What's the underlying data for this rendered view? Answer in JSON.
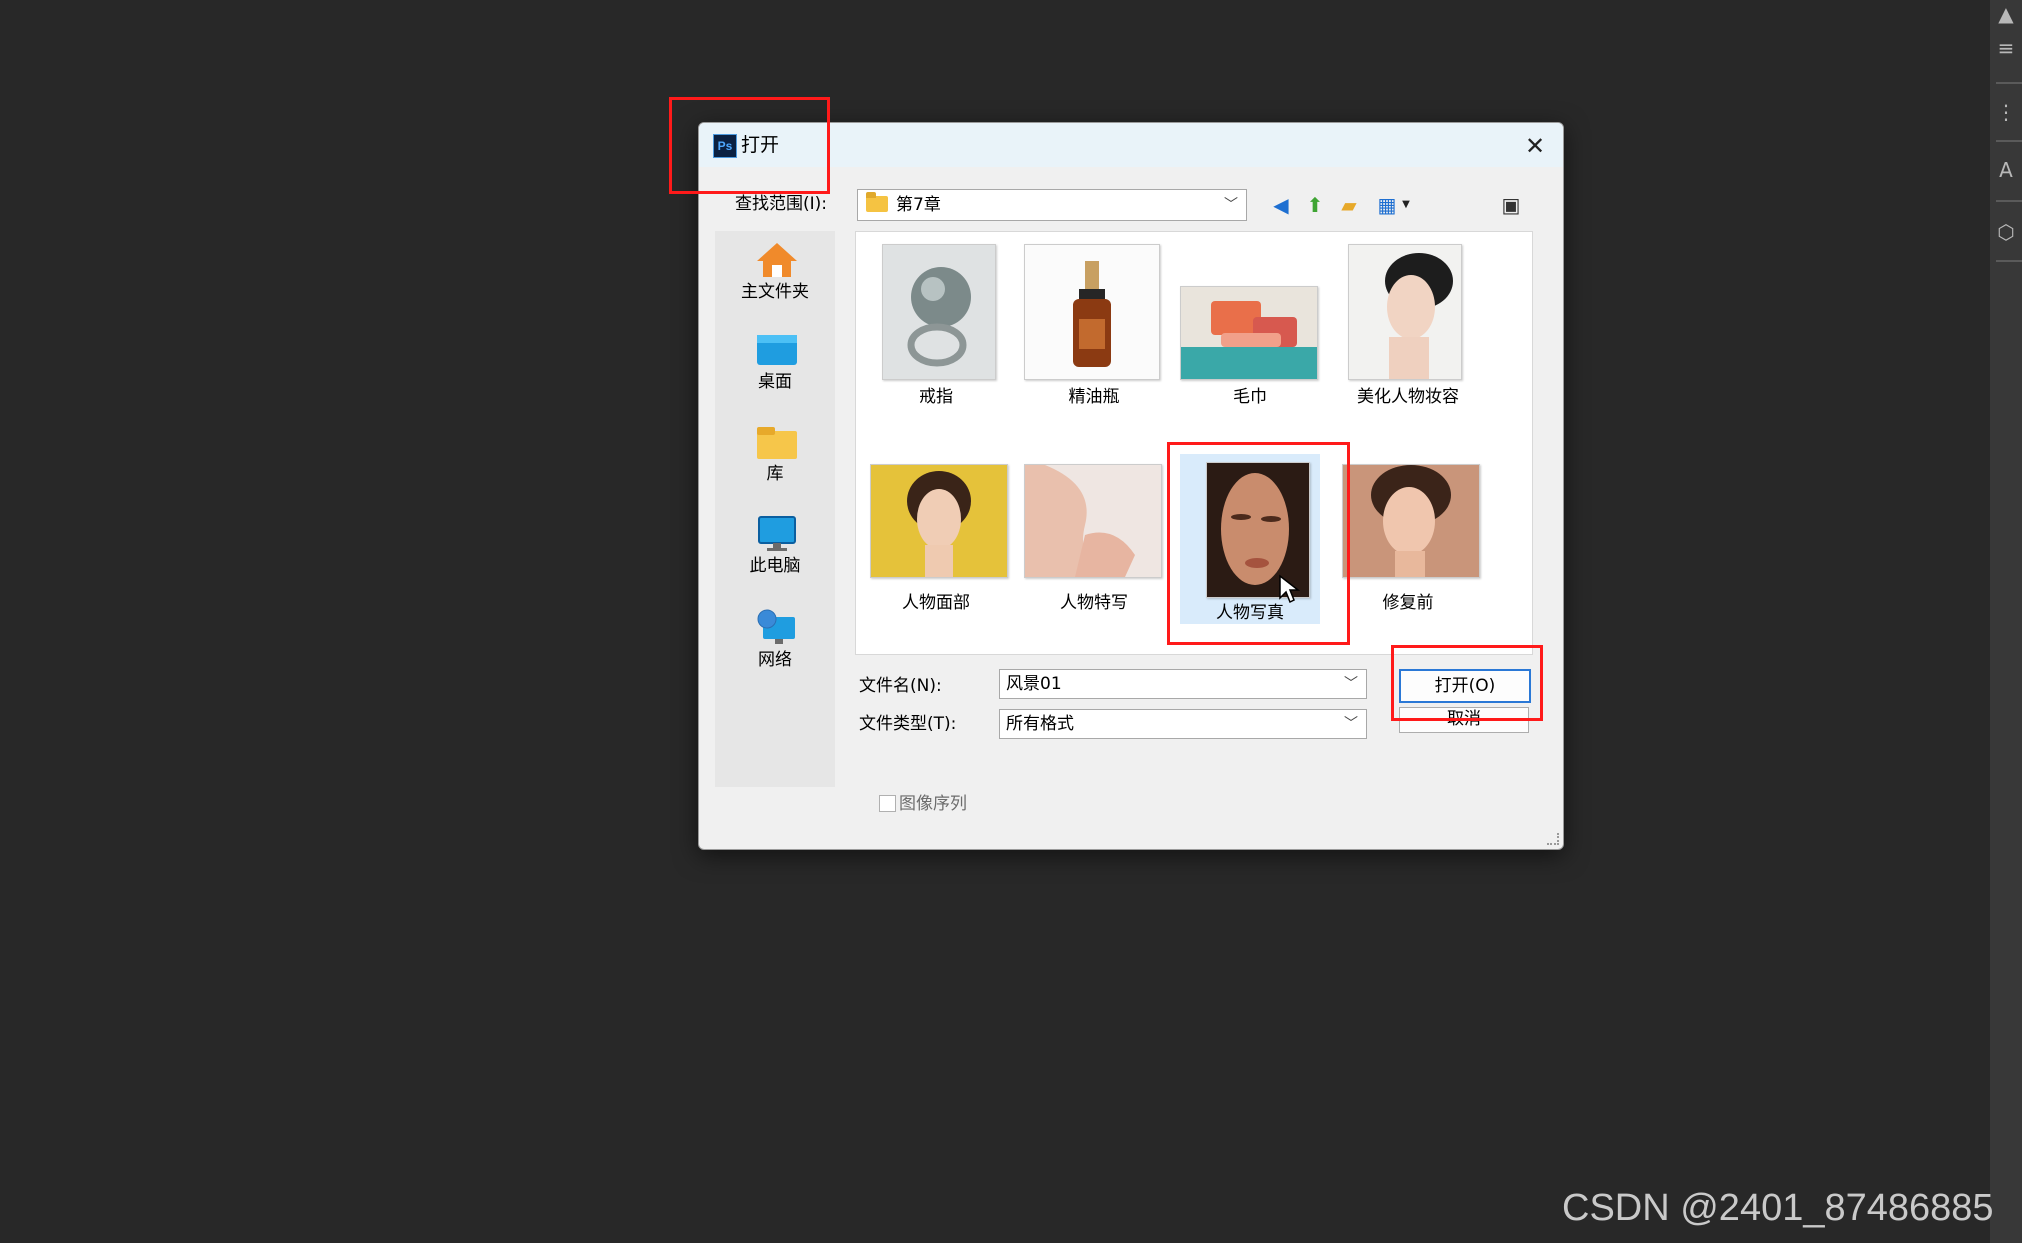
{
  "dialog": {
    "app_icon": "ps-icon",
    "title": "打开",
    "close_icon": "close-icon",
    "look_in_label": "查找范围(I):",
    "look_in_value": "第7章",
    "toolbar_icons": [
      "back-icon",
      "up-folder-icon",
      "new-folder-icon",
      "view-menu-icon",
      "bridge-icon"
    ]
  },
  "places": [
    {
      "label": "主文件夹",
      "icon": "home-icon"
    },
    {
      "label": "桌面",
      "icon": "desktop-icon"
    },
    {
      "label": "库",
      "icon": "library-folder-icon"
    },
    {
      "label": "此电脑",
      "icon": "computer-icon"
    },
    {
      "label": "网络",
      "icon": "network-icon"
    }
  ],
  "files": [
    {
      "label": "戒指"
    },
    {
      "label": "精油瓶"
    },
    {
      "label": "毛巾"
    },
    {
      "label": "美化人物妆容"
    },
    {
      "label": "人物面部"
    },
    {
      "label": "人物特写"
    },
    {
      "label": "人物写真"
    },
    {
      "label": "修复前"
    }
  ],
  "form": {
    "file_name_label": "文件名(N):",
    "file_name_value": "风景01",
    "file_type_label": "文件类型(T):",
    "file_type_value": "所有格式",
    "open_button": "打开(O)",
    "cancel_button": "取消",
    "image_sequence_label": "图像序列",
    "image_sequence_checked": false
  },
  "colors": {
    "highlight": "#ff1a1a",
    "background": "#282828",
    "accent": "#2a78d6"
  },
  "watermark": "CSDN @2401_87486885"
}
